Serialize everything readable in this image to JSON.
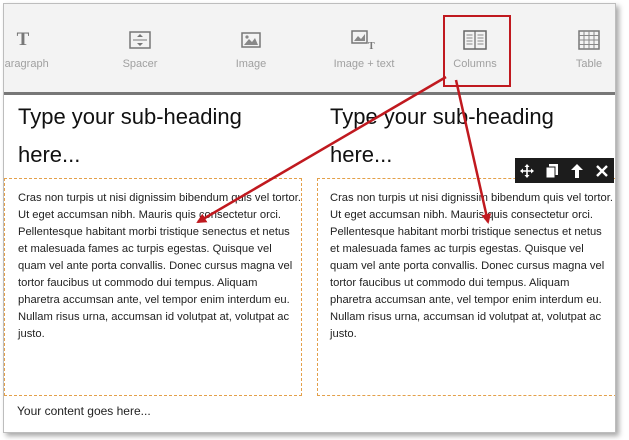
{
  "toolbar": {
    "items": [
      {
        "label": "Paragraph",
        "icon": "paragraph-icon",
        "glyph": "T"
      },
      {
        "label": "Spacer",
        "icon": "spacer-icon"
      },
      {
        "label": "Image",
        "icon": "image-icon"
      },
      {
        "label": "Image + text",
        "icon": "image-text-icon"
      },
      {
        "label": "Columns",
        "icon": "columns-icon"
      },
      {
        "label": "Table",
        "icon": "table-icon"
      }
    ]
  },
  "columns": [
    {
      "heading": "Type your sub-heading here...",
      "body": "Cras non turpis ut nisi dignissim bibendum quis vel tortor. Ut eget accumsan nibh. Mauris quis consectetur orci. Pellentesque habitant morbi tristique senectus et netus et malesuada fames ac turpis egestas. Quisque vel quam vel ante porta convallis. Donec cursus magna vel tortor faucibus ut commodo dui tempus. Aliquam pharetra accumsan ante, vel tempor enim interdum eu. Nullam risus urna, accumsan id volutpat at, volutpat ac justo."
    },
    {
      "heading": "Type your sub-heading here...",
      "body": "Cras non turpis ut nisi dignissim bibendum quis vel tortor. Ut eget accumsan nibh. Mauris quis consectetur orci. Pellentesque habitant morbi tristique senectus et netus et malesuada fames ac turpis egestas. Quisque vel quam vel ante porta convallis. Donec cursus magna vel tortor faucibus ut commodo dui tempus. Aliquam pharetra accumsan ante, vel tempor enim interdum eu. Nullam risus urna, accumsan id volutpat at, volutpat ac justo."
    }
  ],
  "footer": {
    "text": "Your content goes here..."
  },
  "hover_toolbar": {
    "icons": [
      "move-icon",
      "copy-icon",
      "move-up-icon",
      "close-icon"
    ]
  },
  "colors": {
    "highlight": "#c0191f",
    "dashed_border": "#e3a04a",
    "hover_bar": "#1c1c1c"
  }
}
